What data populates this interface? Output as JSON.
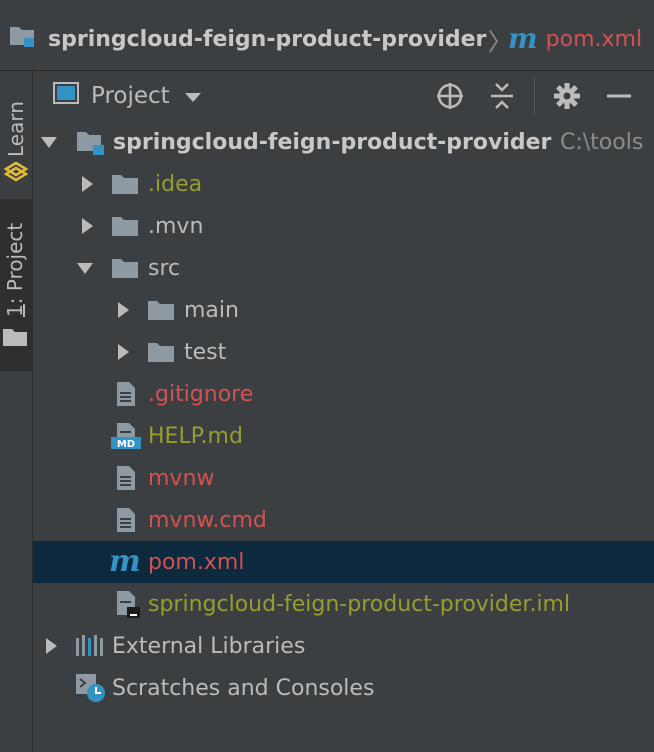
{
  "breadcrumb": {
    "project": "springcloud-feign-product-provider",
    "file": "pom.xml",
    "separator": "〉"
  },
  "stripe": {
    "learn": "Learn",
    "project_number": "1",
    "project_label": ": Project"
  },
  "panel": {
    "title": "Project"
  },
  "tree": {
    "root": {
      "label": "springcloud-feign-product-provider",
      "path": "C:\\tools"
    },
    "items": [
      {
        "label": ".idea",
        "color": "#999c2e"
      },
      {
        "label": ".mvn",
        "color": "#bbbbbb"
      },
      {
        "label": "src",
        "color": "#bbbbbb"
      },
      {
        "label": "main",
        "color": "#bbbbbb"
      },
      {
        "label": "test",
        "color": "#bbbbbb"
      },
      {
        "label": ".gitignore",
        "color": "#d25252"
      },
      {
        "label": "HELP.md",
        "color": "#999c2e"
      },
      {
        "label": "mvnw",
        "color": "#d25252"
      },
      {
        "label": "mvnw.cmd",
        "color": "#d25252"
      },
      {
        "label": "pom.xml",
        "color": "#d25252"
      },
      {
        "label": "springcloud-feign-product-provider.iml",
        "color": "#999c2e"
      },
      {
        "label": "External Libraries",
        "color": "#bbbbbb"
      },
      {
        "label": "Scratches and Consoles",
        "color": "#bbbbbb"
      }
    ],
    "md_badge": "MD",
    "maven_glyph": "m"
  },
  "colors": {
    "background": "#3c3f41",
    "selection": "#0d293e",
    "folder": "#8d99a3",
    "accent_blue": "#3592c4",
    "vcs_red": "#d25252",
    "vcs_olive": "#999c2e"
  }
}
